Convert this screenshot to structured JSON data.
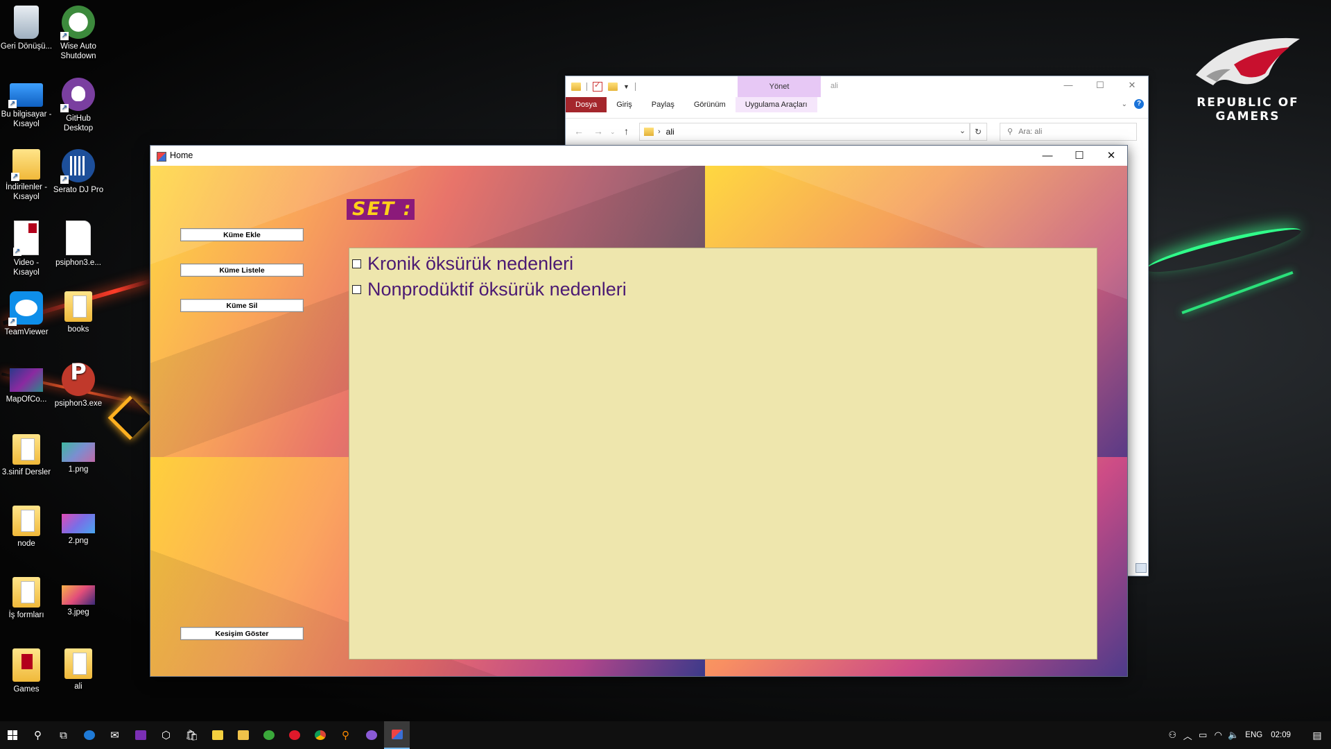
{
  "desktop": {
    "icons": [
      {
        "label": "Geri Dönüşü...",
        "icon": "recycle-bin-icon"
      },
      {
        "label": "Wise Auto Shutdown",
        "icon": "wise-auto-shutdown-icon"
      },
      {
        "label": "Bu bilgisayar - Kısayol",
        "icon": "this-pc-icon"
      },
      {
        "label": "GitHub Desktop",
        "icon": "github-desktop-icon"
      },
      {
        "label": "İndirilenler - Kısayol",
        "icon": "downloads-folder-icon"
      },
      {
        "label": "Serato DJ Pro",
        "icon": "serato-dj-icon"
      },
      {
        "label": "Video - Kısayol",
        "icon": "video-shortcut-icon"
      },
      {
        "label": "psiphon3.e...",
        "icon": "file-icon"
      },
      {
        "label": "TeamViewer",
        "icon": "teamviewer-icon"
      },
      {
        "label": "books",
        "icon": "folder-icon"
      },
      {
        "label": "MapOfCo...",
        "icon": "image-file-icon"
      },
      {
        "label": "psiphon3.exe",
        "icon": "psiphon-icon"
      },
      {
        "label": "3.sinif Dersler",
        "icon": "folder-icon"
      },
      {
        "label": "1.png",
        "icon": "image-file-icon"
      },
      {
        "label": "node",
        "icon": "folder-icon"
      },
      {
        "label": "2.png",
        "icon": "image-file-icon"
      },
      {
        "label": "İş formları",
        "icon": "folder-icon"
      },
      {
        "label": "3.jpeg",
        "icon": "image-file-icon"
      },
      {
        "label": "Games",
        "icon": "games-folder-icon"
      },
      {
        "label": "ali",
        "icon": "folder-icon"
      }
    ],
    "wallpaper_brand": {
      "line1": "REPUBLIC OF",
      "line2": "GAMERS"
    }
  },
  "explorer": {
    "title": "ali",
    "contextual_tab": "Yönet",
    "tabs": [
      "Dosya",
      "Giriş",
      "Paylaş",
      "Görünüm",
      "Uygulama Araçları"
    ],
    "address": "ali",
    "search_placeholder": "Ara: ali"
  },
  "home_window": {
    "title": "Home",
    "buttons": {
      "add": "Küme Ekle",
      "list": "Küme Listele",
      "delete": "Küme Sil",
      "intersection": "Kesişim Göster"
    },
    "set_label": "SET :",
    "set_items": [
      {
        "label": "Kronik öksürük nedenleri",
        "checked": false
      },
      {
        "label": "Nonprodüktif öksürük nedenleri",
        "checked": false
      }
    ],
    "colors": {
      "set_label_bg": "#8b1a7a",
      "set_label_fg": "#ffd11a",
      "list_bg": "#eee6ad",
      "list_fg": "#4b1a73"
    }
  },
  "taskbar": {
    "items": [
      "start-icon",
      "search-icon",
      "task-view-icon",
      "edge-icon",
      "mail-icon",
      "onenote-icon",
      "3d-viewer-icon",
      "store-icon",
      "sticky-notes-icon",
      "file-explorer-icon",
      "xbox-icon",
      "opera-icon",
      "chrome-icon",
      "search-tool-icon",
      "app-icon",
      "home-app-icon"
    ],
    "language": "ENG",
    "time": "02:09"
  }
}
